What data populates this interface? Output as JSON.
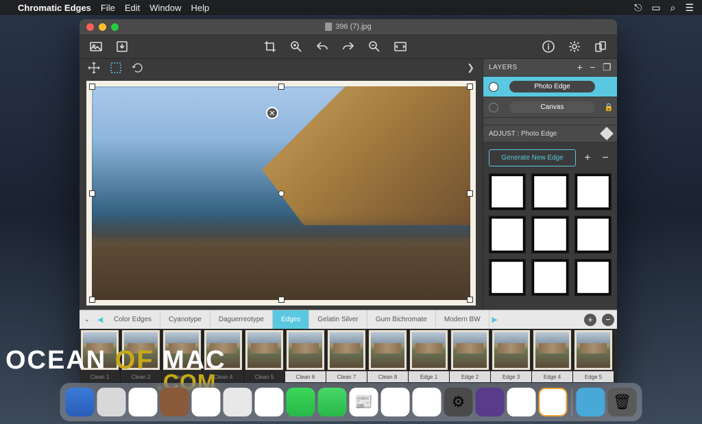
{
  "menubar": {
    "app_name": "Chromatic Edges",
    "items": [
      "File",
      "Edit",
      "Window",
      "Help"
    ]
  },
  "window": {
    "title": "396 (7).jpg"
  },
  "layers": {
    "title": "LAYERS",
    "items": [
      {
        "name": "Photo Edge",
        "active": true,
        "locked": false
      },
      {
        "name": "Canvas",
        "active": false,
        "locked": true
      }
    ]
  },
  "adjust": {
    "title": "ADJUST : Photo Edge",
    "generate_label": "Generate New Edge"
  },
  "filter_tabs": [
    "Color Edges",
    "Cyanotype",
    "Daguerreotype",
    "Edges",
    "Gelatin Silver",
    "Gum Bichromate",
    "Modern BW"
  ],
  "filter_active_index": 3,
  "thumbnails": [
    "Clean 1",
    "Clean 2",
    "Clean 3",
    "Clean 4",
    "Clean 5",
    "Clean 6",
    "Clean 7",
    "Clean 8",
    "Edge 1",
    "Edge 2",
    "Edge 3",
    "Edge 4",
    "Edge 5"
  ],
  "watermark": {
    "t1": "OCEAN",
    "t2": "OF",
    "t3": "MAC",
    "com": ".COM"
  }
}
